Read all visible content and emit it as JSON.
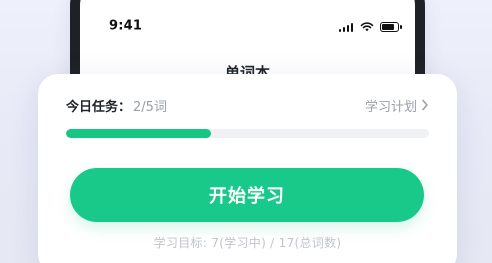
{
  "phone": {
    "status_time": "9:41",
    "app_title": "单词本"
  },
  "card": {
    "task_label": "今日任务：",
    "task_count": "2/5词",
    "plan_link_label": "学习计划",
    "progress": {
      "current": 2,
      "total": 5,
      "fraction": 0.4,
      "color": "#16c784"
    },
    "start_button_label": "开始学习",
    "target_text": "学习目标: 7(学习中) / 17(总词数)"
  },
  "colors": {
    "accent": "#19c989",
    "muted_text": "#9aa0a6",
    "subtle_text": "#c0c4cc",
    "title_text": "#1f2329",
    "track": "#f0f1f5"
  },
  "icons": {
    "plan_chevron": "chevron-right-icon",
    "signal": "signal-icon",
    "wifi": "wifi-icon",
    "battery": "battery-icon"
  }
}
